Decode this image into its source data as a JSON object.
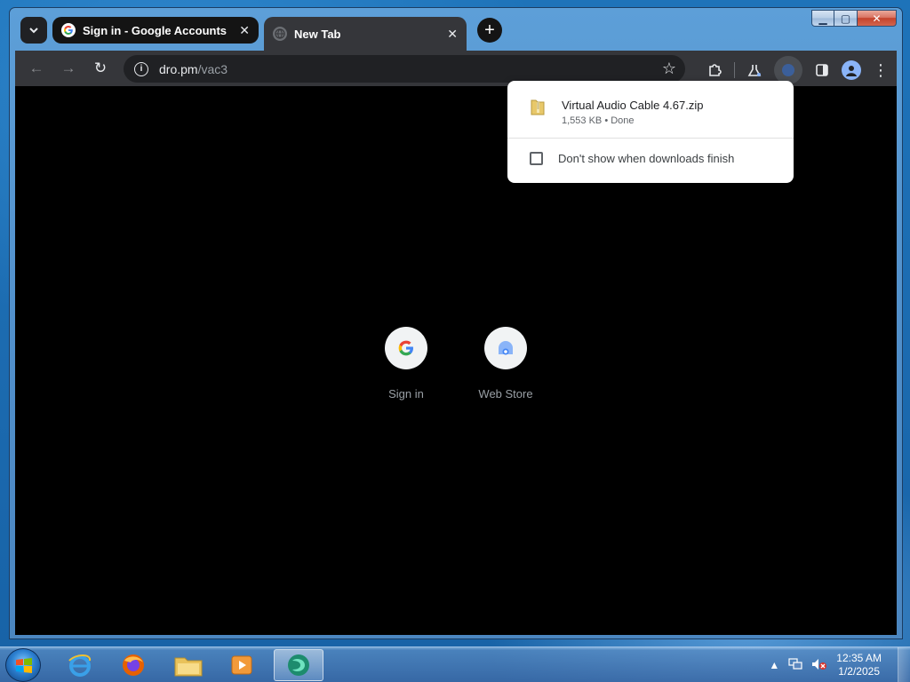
{
  "browser": {
    "tabs": [
      {
        "title": "Sign in - Google Accounts",
        "active": false
      },
      {
        "title": "New Tab",
        "active": true
      }
    ],
    "address_bar": {
      "domain": "dro.pm",
      "path": "/vac3"
    }
  },
  "downloads": {
    "item": {
      "filename": "Virtual Audio Cable 4.67.zip",
      "meta": "1,553 KB • Done"
    },
    "option_label": "Don't show when downloads finish",
    "option_checked": false
  },
  "new_tab": {
    "shortcuts": [
      {
        "label": "Sign in",
        "icon": "google-g-icon"
      },
      {
        "label": "Web Store",
        "icon": "web-store-icon"
      }
    ]
  },
  "taskbar": {
    "apps": [
      "internet-explorer-icon",
      "firefox-icon",
      "file-explorer-icon",
      "media-player-icon",
      "active-app-icon"
    ],
    "clock": {
      "time": "12:35 AM",
      "date": "1/2/2025"
    }
  },
  "colors": {
    "content_bg": "#000000",
    "toolbar_bg": "#35363a",
    "omnibox_bg": "#202124",
    "accent": "#8ab4f8"
  }
}
